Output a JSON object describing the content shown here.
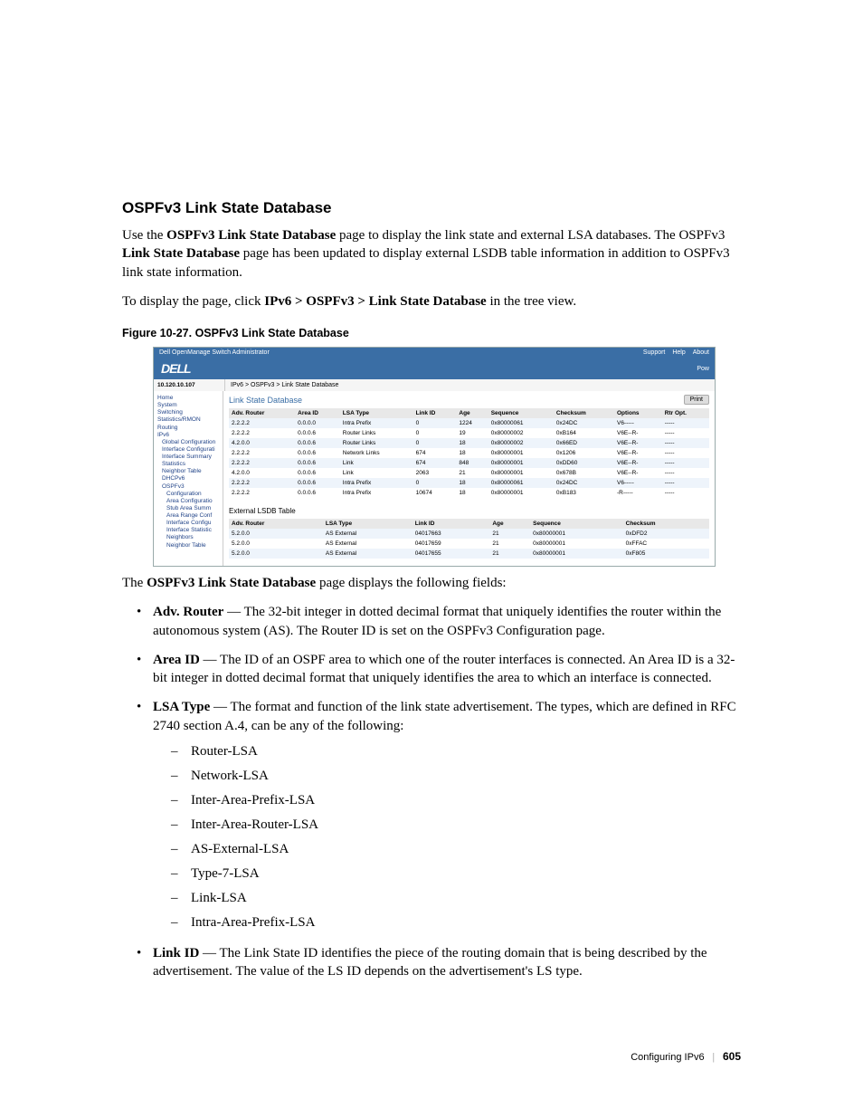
{
  "section_heading": "OSPFv3 Link State Database",
  "para1": {
    "pre": "Use the ",
    "b1": "OSPFv3 Link State Database",
    "mid": " page to display the link state and external LSA databases. The OSPFv3 ",
    "b2": "Link State Database",
    "post": " page has been updated to display external LSDB table information in addition to OSPFv3 link state information."
  },
  "para2": {
    "pre": "To display the page, click ",
    "b": "IPv6 > OSPFv3 > Link State Database",
    "post": " in the tree view."
  },
  "figure_caption": "Figure 10-27.    OSPFv3 Link State Database",
  "screenshot": {
    "topbar_title": "Dell OpenManage Switch Administrator",
    "topbar_links": [
      "Support",
      "Help",
      "About"
    ],
    "logo": "DELL",
    "logo_sub": "Pow",
    "ip": "10.120.10.107",
    "breadcrumb": "IPv6 > OSPFv3 > Link State Database",
    "tree": [
      {
        "cls": "t1",
        "text": "Home"
      },
      {
        "cls": "t1",
        "text": "System"
      },
      {
        "cls": "t1",
        "text": "Switching"
      },
      {
        "cls": "t1",
        "text": "Statistics/RMON"
      },
      {
        "cls": "t1",
        "text": "Routing"
      },
      {
        "cls": "t1",
        "text": "IPv6"
      },
      {
        "cls": "t2",
        "text": "Global Configuration"
      },
      {
        "cls": "t2",
        "text": "Interface Configurati"
      },
      {
        "cls": "t2",
        "text": "Interface Summary"
      },
      {
        "cls": "t2",
        "text": "Statistics"
      },
      {
        "cls": "t2",
        "text": "Neighbor Table"
      },
      {
        "cls": "t2",
        "text": "DHCPv6"
      },
      {
        "cls": "t2",
        "text": "OSPFv3"
      },
      {
        "cls": "t3",
        "text": "Configuration"
      },
      {
        "cls": "t3",
        "text": "Area Configuratio"
      },
      {
        "cls": "t3",
        "text": "Stub Area Summ"
      },
      {
        "cls": "t3",
        "text": "Area Range Conf"
      },
      {
        "cls": "t3",
        "text": "Interface Configu"
      },
      {
        "cls": "t3",
        "text": "Interface Statistic"
      },
      {
        "cls": "t3",
        "text": "Neighbors"
      },
      {
        "cls": "t3",
        "text": "Neighbor Table"
      }
    ],
    "main_title": "Link State Database",
    "print_label": "Print",
    "tbl1_headers": [
      "Adv. Router",
      "Area ID",
      "LSA Type",
      "Link ID",
      "Age",
      "Sequence",
      "Checksum",
      "Options",
      "Rtr Opt."
    ],
    "tbl1_rows": [
      [
        "2.2.2.2",
        "0.0.0.0",
        "Intra Prefix",
        "0",
        "1224",
        "0x80000061",
        "0x24DC",
        "V6-----",
        "-----"
      ],
      [
        "2.2.2.2",
        "0.0.0.6",
        "Router Links",
        "0",
        "19",
        "0x80000002",
        "0xB164",
        "V6E--R-",
        "-----"
      ],
      [
        "4.2.0.0",
        "0.0.0.6",
        "Router Links",
        "0",
        "18",
        "0x80000002",
        "0x66ED",
        "V6E--R-",
        "-----"
      ],
      [
        "2.2.2.2",
        "0.0.0.6",
        "Network Links",
        "674",
        "18",
        "0x80000001",
        "0x1206",
        "V6E--R-",
        "-----"
      ],
      [
        "2.2.2.2",
        "0.0.0.6",
        "Link",
        "674",
        "848",
        "0x80000001",
        "0xDD60",
        "V6E--R-",
        "-----"
      ],
      [
        "4.2.0.0",
        "0.0.0.6",
        "Link",
        "2063",
        "21",
        "0x80000001",
        "0x678B",
        "V6E--R-",
        "-----"
      ],
      [
        "2.2.2.2",
        "0.0.0.6",
        "Intra Prefix",
        "0",
        "18",
        "0x80000061",
        "0x24DC",
        "V6-----",
        "-----"
      ],
      [
        "2.2.2.2",
        "0.0.0.6",
        "Intra Prefix",
        "10674",
        "18",
        "0x80000001",
        "0xB183",
        "-R-----",
        "-----"
      ]
    ],
    "ext_title": "External LSDB Table",
    "tbl2_headers": [
      "Adv. Router",
      "LSA Type",
      "Link ID",
      "Age",
      "Sequence",
      "Checksum"
    ],
    "tbl2_rows": [
      [
        "5.2.0.0",
        "AS External",
        "04017663",
        "21",
        "0x80000001",
        "0xDFD2"
      ],
      [
        "5.2.0.0",
        "AS External",
        "04017659",
        "21",
        "0x80000001",
        "0xFFAC"
      ],
      [
        "5.2.0.0",
        "AS External",
        "04017655",
        "21",
        "0x80000001",
        "0xF805"
      ]
    ]
  },
  "para3": {
    "pre": "The ",
    "b": "OSPFv3 Link State Database",
    "post": " page displays the following fields:"
  },
  "fields": {
    "adv_router": {
      "term": "Adv. Router",
      "desc": " — The 32-bit integer in dotted decimal format that uniquely identifies the router within the autonomous system (AS). The Router ID is set on the OSPFv3 Configuration page."
    },
    "area_id": {
      "term": "Area ID",
      "desc": " — The ID of an OSPF area to which one of the router interfaces is connected. An Area ID is a 32-bit integer in dotted decimal format that uniquely identifies the area to which an interface is connected."
    },
    "lsa_type": {
      "term": "LSA Type",
      "desc": " — The format and function of the link state advertisement. The types, which are defined in RFC 2740 section A.4, can be any of the following:",
      "items": [
        "Router-LSA",
        "Network-LSA",
        "Inter-Area-Prefix-LSA",
        "Inter-Area-Router-LSA",
        "AS-External-LSA",
        "Type-7-LSA",
        "Link-LSA",
        "Intra-Area-Prefix-LSA"
      ]
    },
    "link_id": {
      "term": "Link ID",
      "desc": " — The Link State ID identifies the piece of the routing domain that is being described by the advertisement. The value of the LS ID depends on the advertisement's LS type."
    }
  },
  "footer": {
    "section": "Configuring IPv6",
    "page": "605"
  }
}
